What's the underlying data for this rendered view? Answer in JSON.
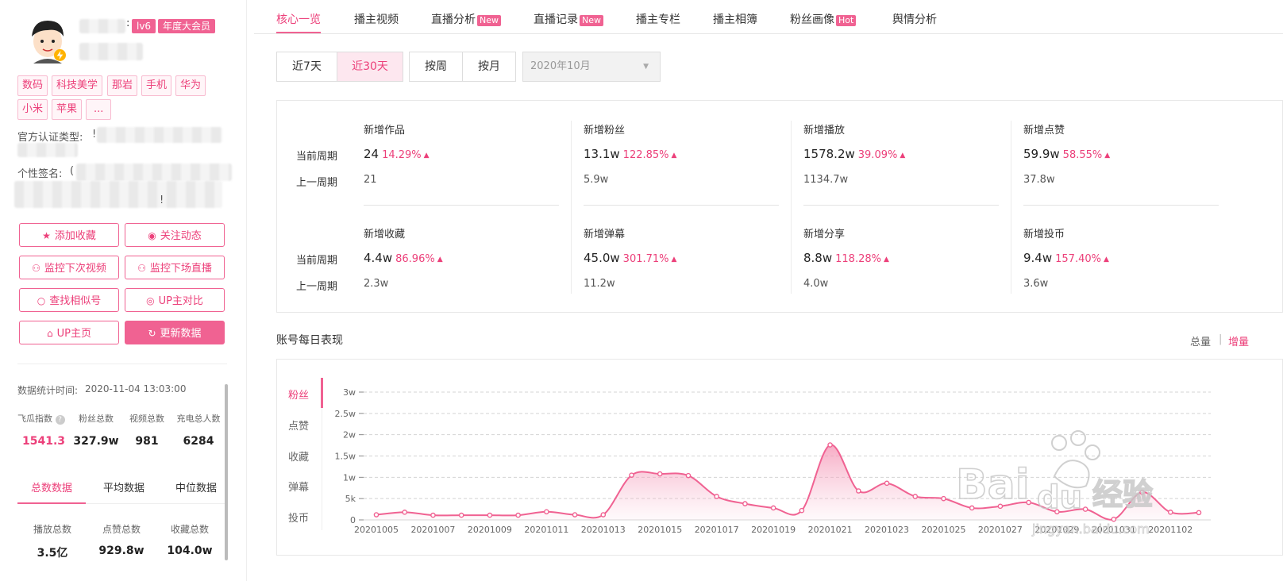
{
  "profile": {
    "level": "lv6",
    "vip": "年度大会员",
    "name_sep": ":",
    "tags": [
      "数码",
      "科技美学",
      "那岩",
      "手机",
      "华为",
      "小米",
      "苹果",
      "..."
    ],
    "cert_label": "官方认证类型:",
    "cert_mark": "!",
    "sign_label": "个性签名:",
    "sign_mark": "(",
    "sign_end": "!"
  },
  "actions": {
    "favorite": "添加收藏",
    "follow": "关注动态",
    "monitor_video": "监控下次视频",
    "monitor_live": "监控下场直播",
    "find_similar": "查找相似号",
    "compare": "UP主对比",
    "homepage": "UP主页",
    "refresh": "更新数据"
  },
  "stats": {
    "time_label": "数据统计时间:",
    "time_value": "2020-11-04 13:03:00",
    "items": [
      {
        "label": "飞瓜指数",
        "value": "1541.3",
        "help": "?"
      },
      {
        "label": "粉丝总数",
        "value": "327.9w"
      },
      {
        "label": "视频总数",
        "value": "981"
      },
      {
        "label": "充电总人数",
        "value": "6284"
      }
    ],
    "tabs": [
      "总数数据",
      "平均数据",
      "中位数据"
    ],
    "totals": [
      {
        "label": "播放总数",
        "value": "3.5亿"
      },
      {
        "label": "点赞总数",
        "value": "929.8w"
      },
      {
        "label": "收藏总数",
        "value": "104.0w"
      }
    ]
  },
  "nav": {
    "tabs": [
      {
        "label": "核心一览"
      },
      {
        "label": "播主视频"
      },
      {
        "label": "直播分析",
        "tag": "New"
      },
      {
        "label": "直播记录",
        "tag": "New"
      },
      {
        "label": "播主专栏"
      },
      {
        "label": "播主相簿"
      },
      {
        "label": "粉丝画像",
        "tag": "Hot"
      },
      {
        "label": "舆情分析"
      }
    ]
  },
  "filters": {
    "ranges": [
      "近7天",
      "近30天"
    ],
    "modes": [
      "按周",
      "按月"
    ],
    "month": "2020年10月"
  },
  "metrics": {
    "current_label": "当前周期",
    "previous_label": "上一周期",
    "items": [
      {
        "title": "新增作品",
        "current": "24",
        "change": "14.29%",
        "previous": "21"
      },
      {
        "title": "新增粉丝",
        "current": "13.1w",
        "change": "122.85%",
        "previous": "5.9w"
      },
      {
        "title": "新增播放",
        "current": "1578.2w",
        "change": "39.09%",
        "previous": "1134.7w"
      },
      {
        "title": "新增点赞",
        "current": "59.9w",
        "change": "58.55%",
        "previous": "37.8w"
      },
      {
        "title": "新增收藏",
        "current": "4.4w",
        "change": "86.96%",
        "previous": "2.3w"
      },
      {
        "title": "新增弹幕",
        "current": "45.0w",
        "change": "301.71%",
        "previous": "11.2w"
      },
      {
        "title": "新增分享",
        "current": "8.8w",
        "change": "118.28%",
        "previous": "4.0w"
      },
      {
        "title": "新增投币",
        "current": "9.4w",
        "change": "157.40%",
        "previous": "3.6w"
      }
    ]
  },
  "daily": {
    "title": "账号每日表现",
    "toggle_total": "总量",
    "toggle_sep": "|",
    "toggle_increment": "增量",
    "tabs": [
      "粉丝",
      "点赞",
      "收藏",
      "弹幕",
      "投币"
    ]
  },
  "watermark": "Bai du 经验 jingyan.baidu.com",
  "colors": {
    "accent": "#f06292",
    "accent_text": "#ec407a",
    "area_top": "#f48fb1"
  },
  "chart_data": {
    "type": "area",
    "series": [
      {
        "x": [
          "20201005",
          "20201006",
          "20201007",
          "20201008",
          "20201009",
          "20201010",
          "20201011",
          "20201012",
          "20201013",
          "20201014",
          "20201015",
          "20201016",
          "20201017",
          "20201018",
          "20201019",
          "20201020",
          "20201021",
          "20201022",
          "20201023",
          "20201024",
          "20201025",
          "20201026",
          "20201027",
          "20201028",
          "20201029",
          "20201030",
          "20201031",
          "20201101",
          "20201102",
          "20201103"
        ],
        "values": [
          1200,
          1800,
          1100,
          1100,
          1100,
          1100,
          1900,
          1200,
          1200,
          10500,
          10800,
          10400,
          5500,
          3800,
          2800,
          2200,
          17600,
          6800,
          8600,
          5500,
          5000,
          2800,
          3200,
          4100,
          1900,
          2500,
          150,
          6500,
          1800,
          1700
        ]
      }
    ],
    "x_tick_labels": [
      "20201005",
      "20201007",
      "20201009",
      "20201011",
      "20201013",
      "20201015",
      "20201017",
      "20201019",
      "20201021",
      "20201023",
      "20201025",
      "20201027",
      "20201029",
      "20201031",
      "20201102"
    ],
    "y_tick_labels": [
      "0",
      "5k",
      "1w",
      "1.5w",
      "2w",
      "2.5w",
      "3w"
    ],
    "ylim": [
      0,
      30000
    ],
    "grid": true
  }
}
